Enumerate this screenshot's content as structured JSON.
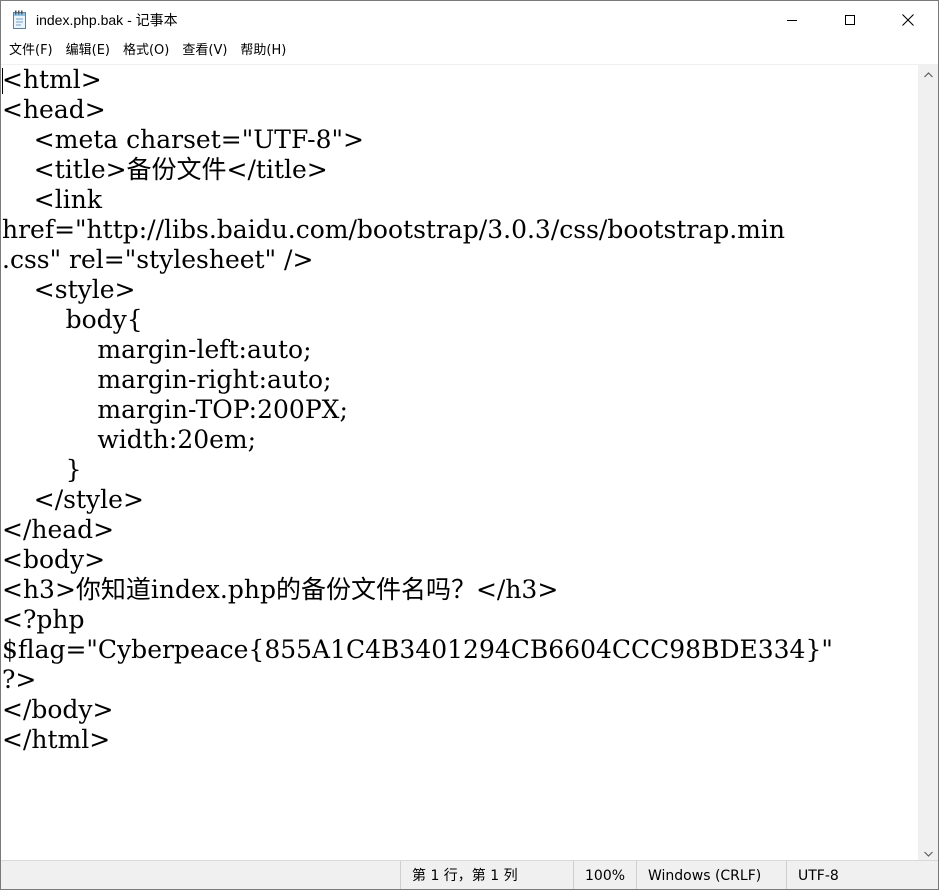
{
  "window": {
    "title": "index.php.bak - 记事本"
  },
  "menu": [
    {
      "label": "文件(F)"
    },
    {
      "label": "编辑(E)"
    },
    {
      "label": "格式(O)"
    },
    {
      "label": "查看(V)"
    },
    {
      "label": "帮助(H)"
    }
  ],
  "editor": {
    "lines": [
      "<html>",
      "<head>",
      "    <meta charset=\"UTF-8\">",
      "    <title>备份文件</title>",
      "    <link",
      "href=\"http://libs.baidu.com/bootstrap/3.0.3/css/bootstrap.min",
      ".css\" rel=\"stylesheet\" />",
      "    <style>",
      "        body{",
      "            margin-left:auto;",
      "            margin-right:auto;",
      "            margin-TOP:200PX;",
      "            width:20em;",
      "        }",
      "    </style>",
      "</head>",
      "<body>",
      "<h3>你知道index.php的备份文件名吗？</h3>",
      "<?php",
      "$flag=\"Cyberpeace{855A1C4B3401294CB6604CCC98BDE334}\"",
      "?>",
      "</body>",
      "</html>"
    ]
  },
  "status": {
    "position": "第 1 行，第 1 列",
    "zoom": "100%",
    "line_ending": "Windows (CRLF)",
    "encoding": "UTF-8"
  },
  "icons": {
    "app": "notepad-icon",
    "minimize": "minimize-icon",
    "maximize": "maximize-icon",
    "close": "close-icon",
    "scroll_up": "scroll-up-arrow-icon",
    "scroll_down": "scroll-down-arrow-icon"
  }
}
